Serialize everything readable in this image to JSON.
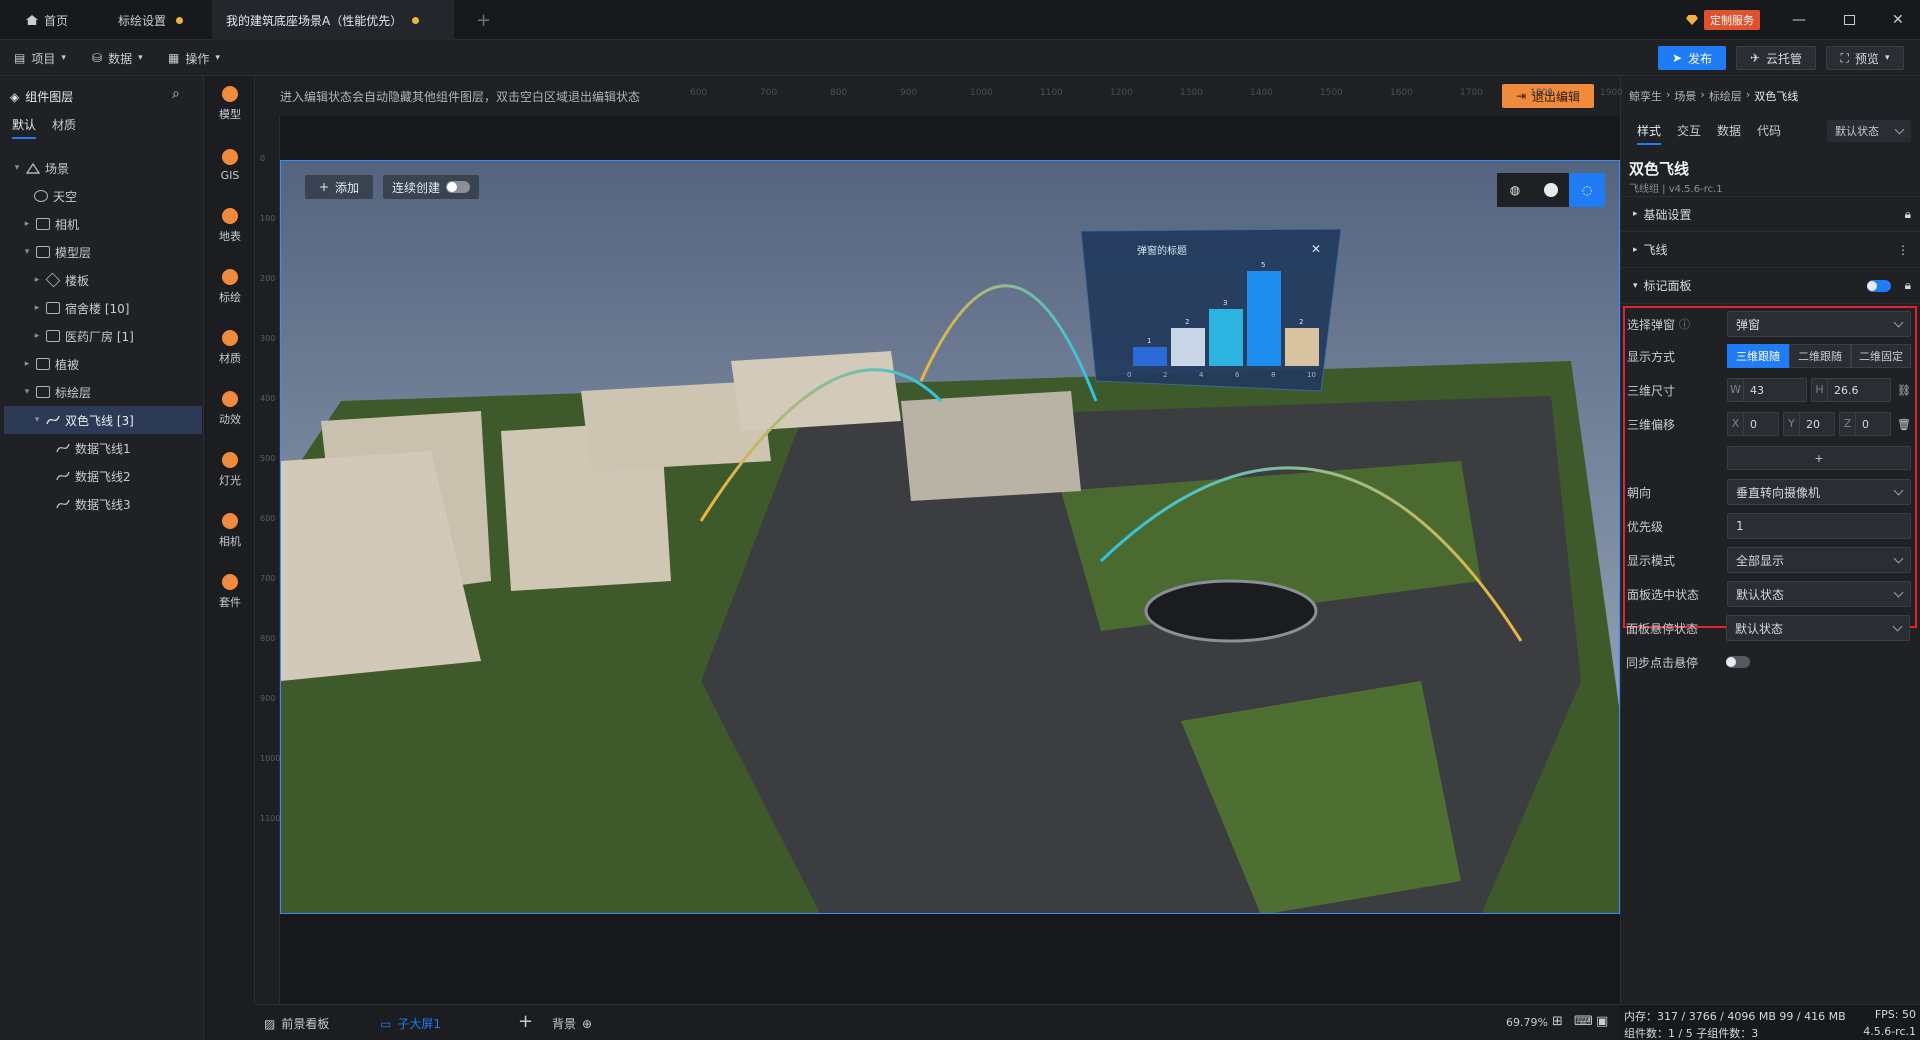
{
  "tabs": [
    {
      "label": "首页"
    },
    {
      "label": "标绘设置"
    },
    {
      "label": "我的建筑底座场景A（性能优先）"
    }
  ],
  "tabbar": {
    "service_label": "定制服务"
  },
  "toolbar": {
    "project": "项目",
    "data": "数据",
    "operate": "操作",
    "publish": "发布",
    "cloud": "云托管",
    "preview": "预览"
  },
  "layers": {
    "title": "组件图层",
    "tab_default": "默认",
    "tab_material": "材质",
    "items": [
      {
        "label": "场景"
      },
      {
        "label": "天空"
      },
      {
        "label": "相机"
      },
      {
        "label": "模型层"
      },
      {
        "label": "楼板"
      },
      {
        "label": "宿舍楼 [10]"
      },
      {
        "label": "医药厂房 [1]"
      },
      {
        "label": "植被"
      },
      {
        "label": "标绘层"
      },
      {
        "label": "双色飞线 [3]"
      },
      {
        "label": "数据飞线1"
      },
      {
        "label": "数据飞线2"
      },
      {
        "label": "数据飞线3"
      }
    ]
  },
  "iconbar": [
    {
      "label": "模型",
      "icon": "model-icon"
    },
    {
      "label": "GIS",
      "icon": "gis-icon"
    },
    {
      "label": "地表",
      "icon": "terrain-icon"
    },
    {
      "label": "标绘",
      "icon": "marker-icon"
    },
    {
      "label": "材质",
      "icon": "material-icon"
    },
    {
      "label": "动效",
      "icon": "effect-icon"
    },
    {
      "label": "灯光",
      "icon": "light-icon"
    },
    {
      "label": "相机",
      "icon": "camera-icon"
    },
    {
      "label": "套件",
      "icon": "kit-icon"
    }
  ],
  "canvas": {
    "hint": "进入编辑状态会自动隐藏其他组件图层，双击空白区域退出编辑状态",
    "exit_edit": "退出编辑",
    "add_label": "添加",
    "continuous_label": "连续创建",
    "ruler_top": [
      "600",
      "700",
      "800",
      "900",
      "1000",
      "1100",
      "1200",
      "1300",
      "1400",
      "1500",
      "1600",
      "1700",
      "1800",
      "1900"
    ],
    "ruler_left": [
      "0",
      "100",
      "200",
      "300",
      "400",
      "500",
      "600",
      "700",
      "800",
      "900",
      "1000",
      "1100"
    ],
    "popup": {
      "title": "弹窗的标题",
      "values": [
        1,
        2,
        3,
        5,
        2
      ],
      "xticks": [
        "0",
        "2",
        "4",
        "6",
        "8",
        "10"
      ]
    }
  },
  "bottom": {
    "tab_fore": "前景看板",
    "tab_sub": "子大屏1",
    "tab_bg": "背景",
    "zoom": "69.79%"
  },
  "props": {
    "breadcrumb": [
      "鲸孪生",
      "场景",
      "标绘层",
      "双色飞线"
    ],
    "tabs": [
      "样式",
      "交互",
      "数据",
      "代码"
    ],
    "state_select": "默认状态",
    "name": "双色飞线",
    "subtitle": "飞线组 | v4.5.6-rc.1",
    "sections": {
      "basic": "基础设置",
      "flyline": "飞线",
      "marker_panel": "标记面板"
    },
    "fields": {
      "popup_label": "选择弹窗",
      "popup_value": "弹窗",
      "display_mode_label": "显示方式",
      "display_modes": [
        "三维跟随",
        "二维跟随",
        "二维固定"
      ],
      "size_label": "三维尺寸",
      "w": "43",
      "h": "26.6",
      "offset_label": "三维偏移",
      "ox": "0",
      "oy": "20",
      "oz": "0",
      "add_label": "+",
      "facing_label": "朝向",
      "facing_value": "垂直转向摄像机",
      "priority_label": "优先级",
      "priority_value": "1",
      "show_mode_label": "显示模式",
      "show_mode_value": "全部显示",
      "selected_state_label": "面板选中状态",
      "selected_state_value": "默认状态",
      "hover_state_label": "面板悬停状态",
      "hover_state_value": "默认状态",
      "sync_label": "同步点击悬停"
    }
  },
  "status": {
    "mem": "内存：317 / 3766 / 4096 MB  99 / 416 MB",
    "fps": "FPS:  50",
    "count": "组件数：1 / 5    子组件数：3",
    "version": "4.5.6-rc.1"
  },
  "colors": {
    "accent": "#1f7cf4",
    "highlight": "#e0252d",
    "orange": "#f08a3c"
  }
}
